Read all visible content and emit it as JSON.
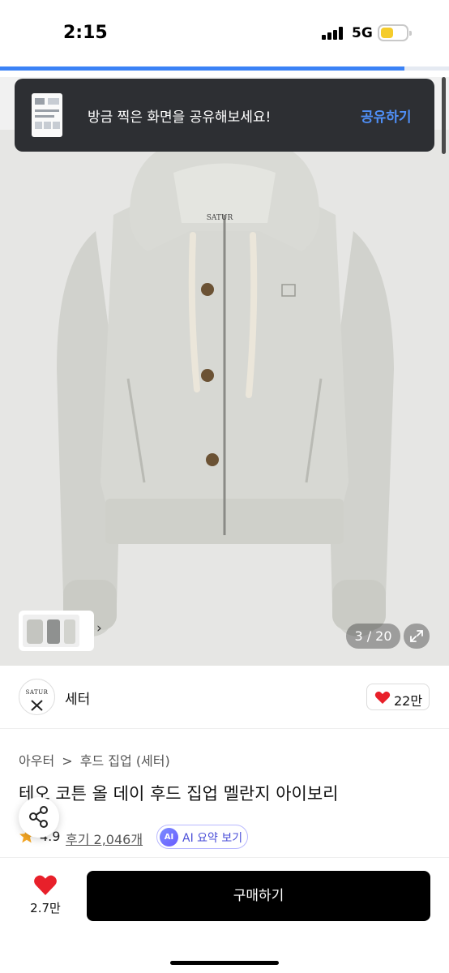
{
  "status": {
    "time": "2:15",
    "network": "5G",
    "battery_color": "#f5cc2b"
  },
  "load_progress": 0.9,
  "toast": {
    "message": "방금 찍은 화면을 공유해보세요!",
    "action": "공유하기"
  },
  "gallery": {
    "counter": "3 / 20",
    "brand_print": "SATUR"
  },
  "shop": {
    "logo_text": "SATUR",
    "name": "세터",
    "likes": "22만"
  },
  "breadcrumb": {
    "category": "아우터",
    "separator": ">",
    "subcategory": "후드 집업 (세터)"
  },
  "product": {
    "title": "테오 코튼 올 데이 후드 집업 멜란지 아이보리",
    "rating": "4.9",
    "reviews": "후기 2,046개",
    "ai_badge": "AI",
    "ai_summary": "AI 요약 보기"
  },
  "bottom": {
    "wish_count": "2.7만",
    "buy_label": "구매하기"
  },
  "colors": {
    "accent_blue": "#4f8ff7",
    "heart_red": "#e8202a",
    "buy_button": "#000000"
  }
}
